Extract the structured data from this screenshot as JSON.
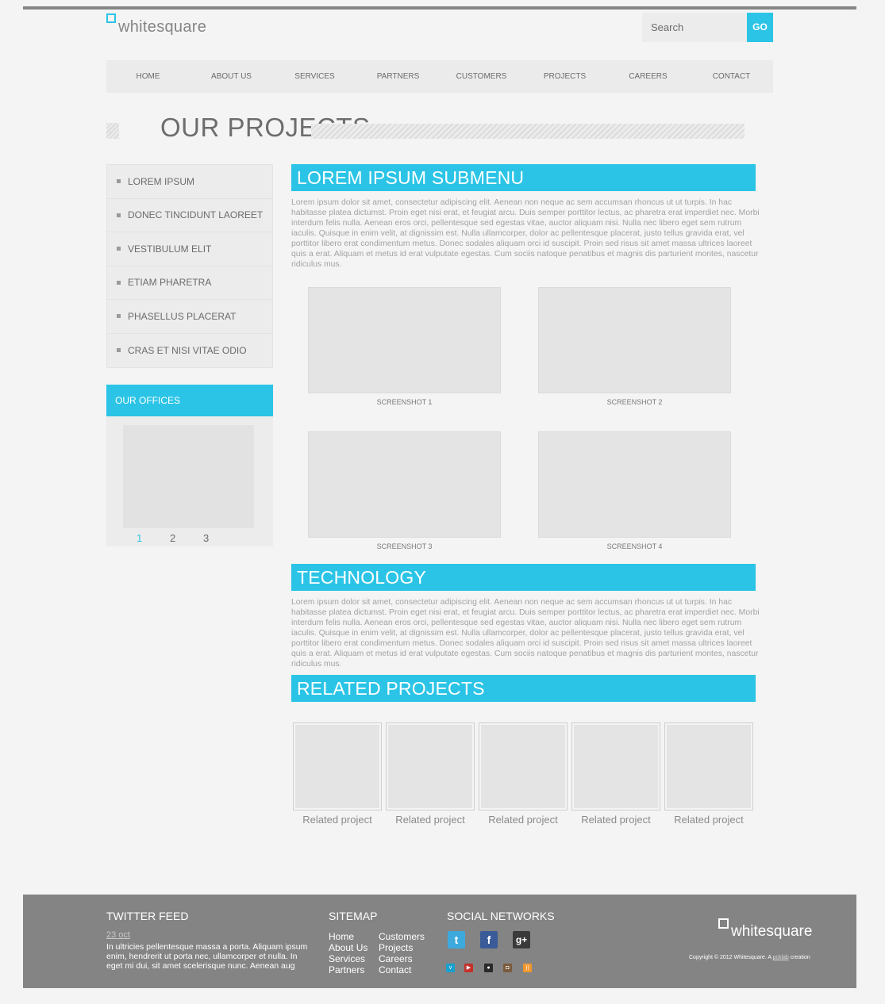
{
  "header": {
    "logo_text": "whitesquare",
    "search_placeholder": "Search",
    "go_label": "GO",
    "nav": [
      "HOME",
      "ABOUT US",
      "SERVICES",
      "PARTNERS",
      "CUSTOMERS",
      "PROJECTS",
      "CAREERS",
      "CONTACT"
    ]
  },
  "page_title": "OUR PROJECTS",
  "sidebar": {
    "menu": [
      "LOREM IPSUM",
      "DONEC TINCIDUNT LAOREET",
      "VESTIBULUM ELIT",
      "ETIAM PHARETRA",
      "PHASELLUS PLACERAT",
      "CRAS ET NISI VITAE ODIO"
    ],
    "offices_title": "OUR OFFICES",
    "pager": [
      "1",
      "2",
      "3"
    ],
    "pager_active": "1"
  },
  "main": {
    "submenu_title": "LOREM IPSUM SUBMENU",
    "submenu_text": "Lorem ipsum dolor sit amet, consectetur adipiscing elit. Aenean non neque ac sem accumsan rhoncus ut ut turpis. In hac habitasse platea dictumst. Proin eget nisi erat, et feugiat arcu. Duis semper porttitor lectus, ac pharetra erat imperdiet nec. Morbi interdum felis nulla. Aenean eros orci, pellentesque sed egestas vitae, auctor aliquam nisi. Nulla nec libero eget sem rutrum iaculis. Quisque in enim velit, at dignissim est. Nulla ullamcorper, dolor ac pellentesque placerat, justo tellus gravida erat, vel porttitor libero erat condimentum metus. Donec sodales aliquam orci id suscipit. Proin sed risus sit amet massa ultrices laoreet quis a erat. Aliquam et metus id erat vulputate egestas. Cum sociis natoque penatibus et magnis dis parturient montes, nascetur ridiculus mus.",
    "screenshots": [
      "SCREENSHOT 1",
      "SCREENSHOT 2",
      "SCREENSHOT 3",
      "SCREENSHOT 4"
    ],
    "technology_title": "TECHNOLOGY",
    "technology_text": "Lorem ipsum dolor sit amet, consectetur adipiscing elit. Aenean non neque ac sem accumsan rhoncus ut ut turpis. In hac habitasse platea dictumst. Proin eget nisi erat, et feugiat arcu. Duis semper porttitor lectus, ac pharetra erat imperdiet nec. Morbi interdum felis nulla. Aenean eros orci, pellentesque sed egestas vitae, auctor aliquam nisi. Nulla nec libero eget sem rutrum iaculis. Quisque in enim velit, at dignissim est. Nulla ullamcorper, dolor ac pellentesque placerat, justo tellus gravida erat, vel porttitor libero erat condimentum metus. Donec sodales aliquam orci id suscipit. Proin sed risus sit amet massa ultrices laoreet quis a erat. Aliquam et metus id erat vulputate egestas. Cum sociis natoque penatibus et magnis dis parturient montes, nascetur ridiculus mus.",
    "related_title": "RELATED PROJECTS",
    "related": [
      "Related project",
      "Related project",
      "Related project",
      "Related project",
      "Related project"
    ]
  },
  "footer": {
    "twitter_title": "TWITTER FEED",
    "twitter_date": "23 oct",
    "twitter_text": "In ultricies pellentesque massa a porta. Aliquam ipsum enim, hendrerit ut porta nec, ullamcorper et nulla. In eget mi dui, sit amet scelerisque nunc. Aenean aug",
    "sitemap_title": "SITEMAP",
    "sitemap_col1": [
      "Home",
      "About Us",
      "Services",
      "Partners"
    ],
    "sitemap_col2": [
      "Customers",
      "Projects",
      "Careers",
      "Contact"
    ],
    "social_title": "SOCIAL NETWORKS",
    "social_large": [
      "twitter-icon",
      "facebook-icon",
      "google-plus-icon"
    ],
    "social_small": [
      "vimeo-icon",
      "youtube-icon",
      "flickr-icon",
      "instagram-icon",
      "rss-icon"
    ],
    "logo_text": "whitesquare",
    "copyright_prefix": "Copyright © 2012 Whitesquare. A",
    "copyright_link": "pcklab",
    "copyright_suffix": "creation"
  },
  "colors": {
    "accent": "#2bc4e6",
    "footer_bg": "#848484",
    "page_bg": "#f4f4f4"
  }
}
